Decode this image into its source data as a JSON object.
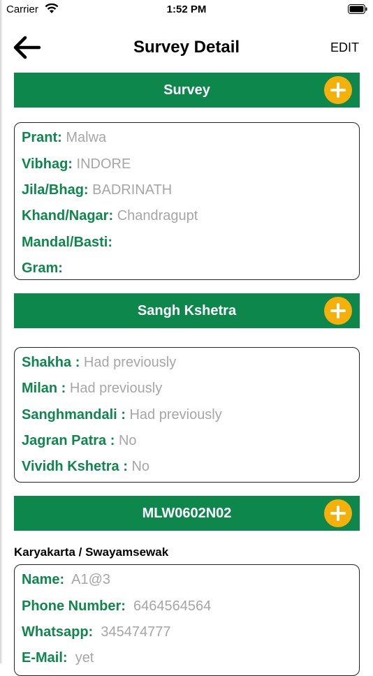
{
  "status_bar": {
    "carrier": "Carrier",
    "time": "1:52 PM"
  },
  "nav": {
    "title": "Survey Detail",
    "edit_label": "EDIT"
  },
  "survey": {
    "header": "Survey",
    "fields": [
      {
        "label": "Prant:",
        "value": "Malwa"
      },
      {
        "label": "Vibhag:",
        "value": "INDORE"
      },
      {
        "label": "Jila/Bhag:",
        "value": "BADRINATH"
      },
      {
        "label": "Khand/Nagar:",
        "value": "Chandragupt"
      },
      {
        "label": "Mandal/Basti:",
        "value": ""
      },
      {
        "label": "Gram:",
        "value": ""
      }
    ]
  },
  "sangh_kshetra": {
    "header": "Sangh Kshetra",
    "fields": [
      {
        "label": "Shakha :",
        "value": "Had previously"
      },
      {
        "label": "Milan :",
        "value": "Had previously"
      },
      {
        "label": "Sanghmandali :",
        "value": "Had previously"
      },
      {
        "label": "Jagran Patra :",
        "value": "No"
      },
      {
        "label": "Vividh Kshetra :",
        "value": "No"
      }
    ]
  },
  "code_section": {
    "header": "MLW0602N02",
    "subtitle": "Karyakarta / Swayamsewak",
    "fields": [
      {
        "label": "Name:",
        "value": "A1@3"
      },
      {
        "label": "Phone Number:",
        "value": "6464564564"
      },
      {
        "label": "Whatsapp:",
        "value": "345474777"
      },
      {
        "label": "E-Mail:",
        "value": "yet"
      }
    ]
  },
  "colors": {
    "accent_green": "#0e874d",
    "plus_orange": "#f5b10a",
    "value_gray": "#a6a6a6"
  }
}
